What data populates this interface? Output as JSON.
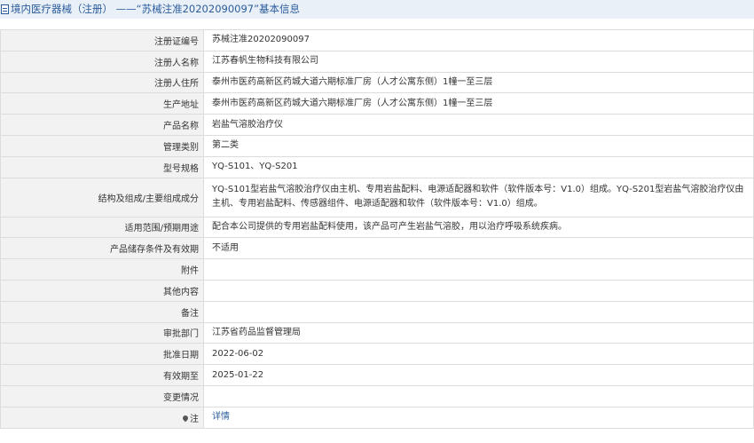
{
  "header": {
    "title": "境内医疗器械（注册） ——“苏械注准20202090097”基本信息"
  },
  "rows": [
    {
      "label": "注册证编号",
      "value": "苏械注准20202090097"
    },
    {
      "label": "注册人名称",
      "value": "江苏春帆生物科技有限公司"
    },
    {
      "label": "注册人住所",
      "value": "泰州市医药高新区药城大道六期标准厂房（人才公寓东侧）1幢一至三层"
    },
    {
      "label": "生产地址",
      "value": "泰州市医药高新区药城大道六期标准厂房（人才公寓东侧）1幢一至三层"
    },
    {
      "label": "产品名称",
      "value": "岩盐气溶胶治疗仪"
    },
    {
      "label": "管理类别",
      "value": "第二类"
    },
    {
      "label": "型号规格",
      "value": "YQ-S101、YQ-S201"
    },
    {
      "label": "结构及组成/主要组成成分",
      "value": "YQ-S101型岩盐气溶胶治疗仪由主机、专用岩盐配料、电源适配器和软件（软件版本号：V1.0）组成。YQ-S201型岩盐气溶胶治疗仪由主机、专用岩盐配料、传感器组件、电源适配器和软件（软件版本号：V1.0）组成。"
    },
    {
      "label": "适用范围/预期用途",
      "value": "配合本公司提供的专用岩盐配料使用，该产品可产生岩盐气溶胶，用以治疗呼吸系统疾病。"
    },
    {
      "label": "产品储存条件及有效期",
      "value": "不适用"
    },
    {
      "label": "附件",
      "value": ""
    },
    {
      "label": "其他内容",
      "value": ""
    },
    {
      "label": "备注",
      "value": ""
    },
    {
      "label": "审批部门",
      "value": "江苏省药品监督管理局"
    },
    {
      "label": "批准日期",
      "value": "2022-06-02"
    },
    {
      "label": "有效期至",
      "value": "2025-01-22"
    },
    {
      "label": "变更情况",
      "value": ""
    }
  ],
  "note_row": {
    "label": "注",
    "link_text": "详情"
  }
}
